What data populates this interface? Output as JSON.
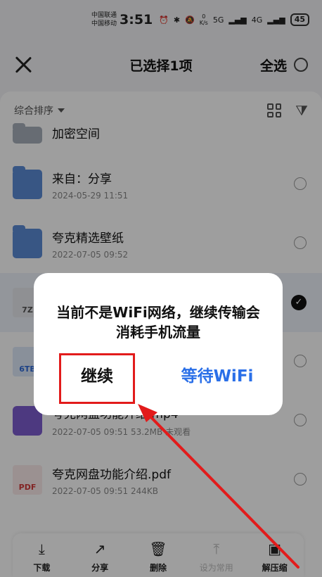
{
  "status_bar": {
    "carrier_1": "中国联通",
    "carrier_2": "中国移动",
    "time": "3:51",
    "net_speed_value": "0",
    "net_speed_unit": "K/s",
    "signal_5g": "5G",
    "signal_4g": "4G",
    "battery": "45"
  },
  "header": {
    "title": "已选择1项",
    "select_all": "全选"
  },
  "toolbar": {
    "sort_label": "综合排序"
  },
  "files": [
    {
      "name": "加密空间",
      "meta": ""
    },
    {
      "name": "来自：分享",
      "meta": "2024-05-29 11:51"
    },
    {
      "name": "夸克精选壁纸",
      "meta": "2022-07-05 09:52"
    },
    {
      "name": "",
      "meta": "",
      "thumb_label": "7Z"
    },
    {
      "name": "",
      "meta": "",
      "thumb_label": "6TB"
    },
    {
      "name": "夸克网盘功能介绍.mp4",
      "meta": "2022-07-05 09:51  53.2MB  未观看"
    },
    {
      "name": "夸克网盘功能介绍.pdf",
      "meta": "2022-07-05 09:51  244KB",
      "thumb_label": "PDF"
    }
  ],
  "bottom_bar": {
    "items": [
      {
        "label": "下载",
        "icon": "download-icon"
      },
      {
        "label": "分享",
        "icon": "share-icon"
      },
      {
        "label": "删除",
        "icon": "trash-icon"
      },
      {
        "label": "设为常用",
        "icon": "pin-icon"
      },
      {
        "label": "解压缩",
        "icon": "unzip-icon"
      }
    ]
  },
  "dialog": {
    "message": "当前不是WiFi网络，继续传输会消耗手机流量",
    "continue_label": "继续",
    "wait_label": "等待WiFi"
  },
  "colors": {
    "accent_blue": "#2a6fe8",
    "annotation_red": "#e21b1b"
  }
}
